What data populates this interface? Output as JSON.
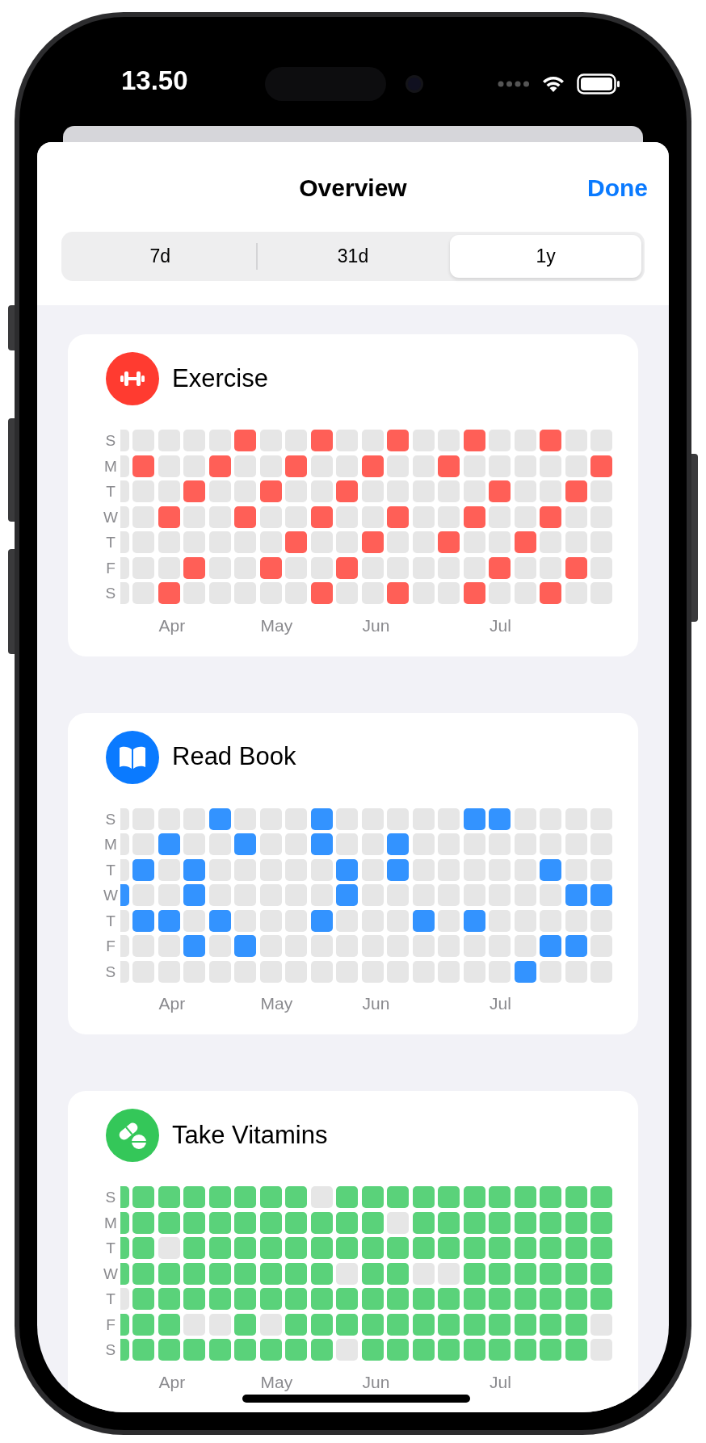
{
  "status_bar": {
    "time": "13.50"
  },
  "sheet": {
    "title": "Overview",
    "done_button": "Done"
  },
  "segments": [
    {
      "label": "7d",
      "selected": false
    },
    {
      "label": "31d",
      "selected": false
    },
    {
      "label": "1y",
      "selected": true
    }
  ],
  "habits": [
    {
      "name": "Exercise",
      "kind": "dumbbell",
      "color": "#ff5f57",
      "rows": [
        {
          "day": "S",
          "done": [
            false,
            false,
            false,
            false,
            false,
            true,
            false,
            false,
            true,
            false,
            false,
            true,
            false,
            false,
            true,
            false,
            false,
            true,
            false,
            false
          ]
        },
        {
          "day": "M",
          "done": [
            false,
            true,
            false,
            false,
            true,
            false,
            false,
            true,
            false,
            false,
            true,
            false,
            false,
            true,
            false,
            false,
            false,
            false,
            false,
            true
          ]
        },
        {
          "day": "T",
          "done": [
            false,
            false,
            false,
            true,
            false,
            false,
            true,
            false,
            false,
            true,
            false,
            false,
            false,
            false,
            false,
            true,
            false,
            false,
            true,
            false
          ]
        },
        {
          "day": "W",
          "done": [
            false,
            false,
            true,
            false,
            false,
            true,
            false,
            false,
            true,
            false,
            false,
            true,
            false,
            false,
            true,
            false,
            false,
            true,
            false,
            false
          ]
        },
        {
          "day": "T",
          "done": [
            false,
            false,
            false,
            false,
            false,
            false,
            false,
            true,
            false,
            false,
            true,
            false,
            false,
            true,
            false,
            false,
            true,
            false,
            false,
            false
          ]
        },
        {
          "day": "F",
          "done": [
            false,
            false,
            false,
            true,
            false,
            false,
            true,
            false,
            false,
            true,
            false,
            false,
            false,
            false,
            false,
            true,
            false,
            false,
            true,
            false
          ]
        },
        {
          "day": "S",
          "done": [
            false,
            false,
            true,
            false,
            false,
            false,
            false,
            false,
            true,
            false,
            false,
            true,
            false,
            false,
            true,
            false,
            false,
            true,
            false,
            false
          ]
        }
      ],
      "months": [
        {
          "label": "Apr"
        },
        {
          "label": "May"
        },
        {
          "label": "Jun"
        },
        {
          "label": "Jul"
        }
      ]
    },
    {
      "name": "Read Book",
      "kind": "book",
      "color": "#3393ff",
      "rows": [
        {
          "day": "S",
          "done": [
            false,
            false,
            false,
            false,
            true,
            false,
            false,
            false,
            true,
            false,
            false,
            false,
            false,
            false,
            true,
            true,
            false,
            false,
            false,
            false
          ]
        },
        {
          "day": "M",
          "done": [
            false,
            false,
            true,
            false,
            false,
            true,
            false,
            false,
            true,
            false,
            false,
            true,
            false,
            false,
            false,
            false,
            false,
            false,
            false,
            false
          ]
        },
        {
          "day": "T",
          "done": [
            false,
            true,
            false,
            true,
            false,
            false,
            false,
            false,
            false,
            true,
            false,
            true,
            false,
            false,
            false,
            false,
            false,
            true,
            false,
            false
          ]
        },
        {
          "day": "W",
          "done": [
            true,
            false,
            false,
            true,
            false,
            false,
            false,
            false,
            false,
            true,
            false,
            false,
            false,
            false,
            false,
            false,
            false,
            false,
            true,
            true
          ]
        },
        {
          "day": "T",
          "done": [
            false,
            true,
            true,
            false,
            true,
            false,
            false,
            false,
            true,
            false,
            false,
            false,
            true,
            false,
            true,
            false,
            false,
            false,
            false,
            false
          ]
        },
        {
          "day": "F",
          "done": [
            false,
            false,
            false,
            true,
            false,
            true,
            false,
            false,
            false,
            false,
            false,
            false,
            false,
            false,
            false,
            false,
            false,
            true,
            true,
            false
          ]
        },
        {
          "day": "S",
          "done": [
            false,
            false,
            false,
            false,
            false,
            false,
            false,
            false,
            false,
            false,
            false,
            false,
            false,
            false,
            false,
            false,
            true,
            false,
            false,
            false
          ]
        }
      ],
      "months": [
        {
          "label": "Apr"
        },
        {
          "label": "May"
        },
        {
          "label": "Jun"
        },
        {
          "label": "Jul"
        }
      ]
    },
    {
      "name": "Take Vitamins",
      "kind": "pills",
      "color": "#5ad27a",
      "rows": [
        {
          "day": "S",
          "done": [
            true,
            true,
            true,
            true,
            true,
            true,
            true,
            true,
            false,
            true,
            true,
            true,
            true,
            true,
            true,
            true,
            true,
            true,
            true,
            true
          ]
        },
        {
          "day": "M",
          "done": [
            true,
            true,
            true,
            true,
            true,
            true,
            true,
            true,
            true,
            true,
            true,
            false,
            true,
            true,
            true,
            true,
            true,
            true,
            true,
            true
          ]
        },
        {
          "day": "T",
          "done": [
            true,
            true,
            false,
            true,
            true,
            true,
            true,
            true,
            true,
            true,
            true,
            true,
            true,
            true,
            true,
            true,
            true,
            true,
            true,
            true
          ]
        },
        {
          "day": "W",
          "done": [
            true,
            true,
            true,
            true,
            true,
            true,
            true,
            true,
            true,
            false,
            true,
            true,
            false,
            false,
            true,
            true,
            true,
            true,
            true,
            true
          ]
        },
        {
          "day": "T",
          "done": [
            false,
            true,
            true,
            true,
            true,
            true,
            true,
            true,
            true,
            true,
            true,
            true,
            true,
            true,
            true,
            true,
            true,
            true,
            true,
            true
          ]
        },
        {
          "day": "F",
          "done": [
            true,
            true,
            true,
            false,
            false,
            true,
            false,
            true,
            true,
            true,
            true,
            true,
            true,
            true,
            true,
            true,
            true,
            true,
            true,
            false
          ]
        },
        {
          "day": "S",
          "done": [
            true,
            true,
            true,
            true,
            true,
            true,
            true,
            true,
            true,
            false,
            true,
            true,
            true,
            true,
            true,
            true,
            true,
            true,
            true,
            false
          ]
        }
      ],
      "months": [
        {
          "label": "Apr"
        },
        {
          "label": "May"
        },
        {
          "label": "Jun"
        },
        {
          "label": "Jul"
        }
      ]
    }
  ]
}
